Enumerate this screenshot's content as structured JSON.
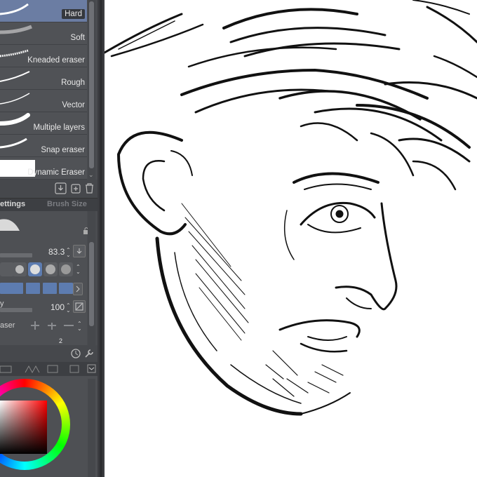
{
  "brushes": [
    {
      "label": "Hard",
      "selected": true
    },
    {
      "label": "Soft",
      "selected": false
    },
    {
      "label": "Kneaded eraser",
      "selected": false
    },
    {
      "label": "Rough",
      "selected": false
    },
    {
      "label": "Vector",
      "selected": false
    },
    {
      "label": "Multiple layers",
      "selected": false
    },
    {
      "label": "Snap eraser",
      "selected": false
    },
    {
      "label": "Dynamic Eraser",
      "selected": false
    }
  ],
  "list_toolbar": {
    "icons": [
      "download-icon",
      "duplicate-icon",
      "trash-icon"
    ]
  },
  "settings_tabs": {
    "tab1": "ettings",
    "tab2": "Brush Size"
  },
  "settings": {
    "size_value": "83.3",
    "density_value": "100",
    "eraser_label": "aser",
    "v_label": "y",
    "partial_value": "2"
  },
  "colors": {
    "accent": "#5d7cb0",
    "selected_row": "#6b7da3",
    "panel_bg": "#4a4c50"
  }
}
